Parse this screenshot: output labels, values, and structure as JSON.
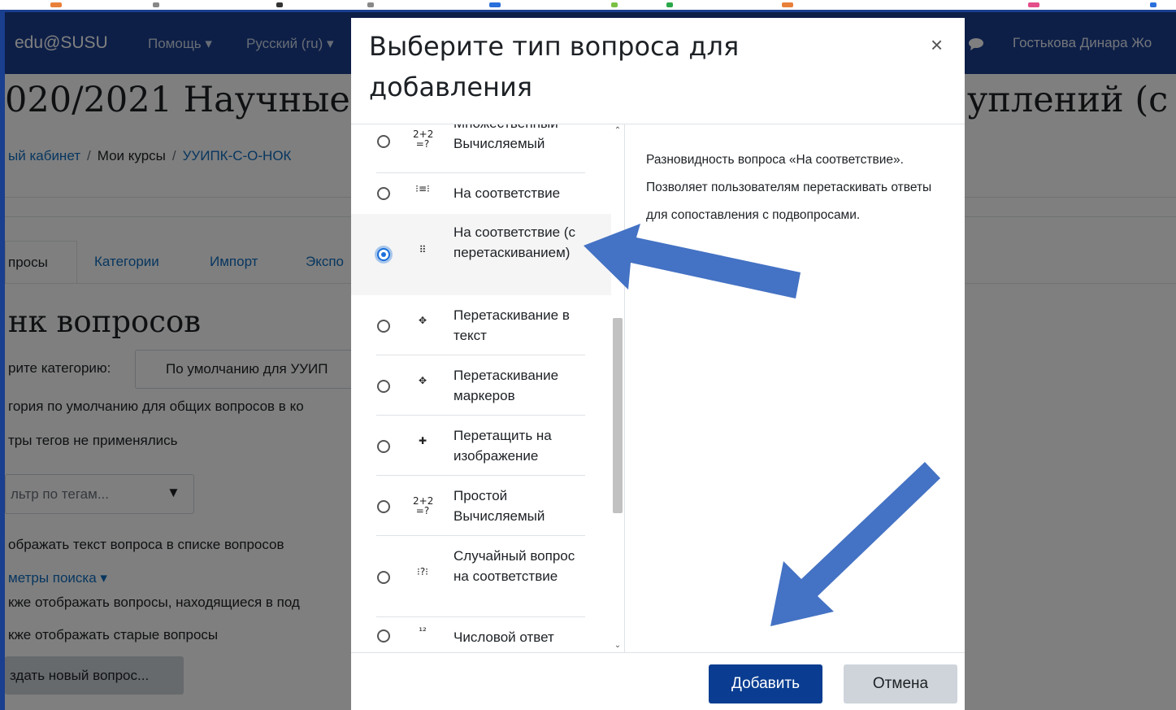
{
  "navbar": {
    "brand": "edu@SUSU",
    "help": "Помощь ▾",
    "language": "Русский (ru) ▾",
    "user": "Гостькова Динара Жо"
  },
  "page": {
    "title_left": "020/2021 Научные",
    "title_right": "уплений (с",
    "breadcrumb": [
      "ый кабинет",
      "Мои курсы",
      "УУИПК-С-О-НОК"
    ],
    "tabs": [
      "просы",
      "Категории",
      "Импорт",
      "Экспо"
    ],
    "section_title": "нк вопросов",
    "category_label": "рите категорию:",
    "category_value": "По умолчанию для УУИП",
    "category_note": "гория по умолчанию для общих вопросов в ко",
    "tag_note": "тры тегов не применялись",
    "tag_filter_placeholder": "льтр по тегам...",
    "tag_filter_arrow": "▼",
    "show_text": "ображать текст вопроса в списке вопросов",
    "search_params": "метры поиска ▾",
    "also_sub": "кже отображать вопросы, находящиеся в под",
    "also_old": "кже отображать старые вопросы",
    "new_question": "здать новый вопрос..."
  },
  "modal": {
    "title": "Выберите тип вопроса для добавления",
    "close": "×",
    "options": [
      {
        "icon": "2+2\n=?",
        "label": "Множественный Вычисляемый"
      },
      {
        "icon": "⁝≡⁝",
        "label": "На соответствие"
      },
      {
        "icon": "⠿",
        "label": "На соответствие (с перетаскиванием)"
      },
      {
        "icon": "✥",
        "label": "Перетаскивание в текст"
      },
      {
        "icon": "✥",
        "label": "Перетаскивание маркеров"
      },
      {
        "icon": "✚",
        "label": "Перетащить на изображение"
      },
      {
        "icon": "2+2\n=?",
        "label": "Простой Вычисляемый"
      },
      {
        "icon": "⁝?⁝",
        "label": "Случайный вопрос на соответствие"
      },
      {
        "icon": "¹²",
        "label": "Числовой ответ"
      }
    ],
    "selected_index": 2,
    "description": "Разновидность вопроса «На соответствие». Позволяет пользователям перетаскивать ответы для сопоставления с подвопросами.",
    "add_button": "Добавить",
    "cancel_button": "Отмена"
  },
  "colors": {
    "navbar": "#1a3f8f",
    "primary_button": "#0a3d91",
    "link": "#0f6cbf",
    "radio_selected": "#1a6fdb",
    "annotation_arrow": "#4472c4"
  }
}
